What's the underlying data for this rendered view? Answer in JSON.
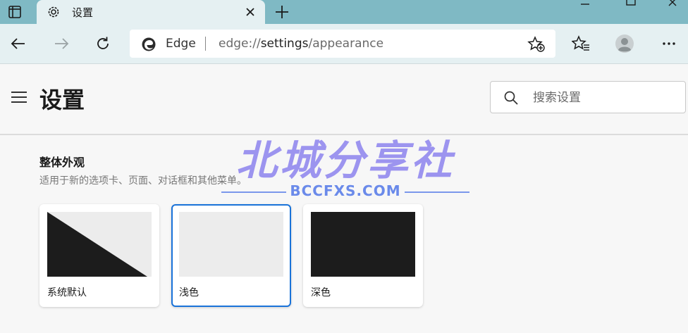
{
  "tab": {
    "title": "设置"
  },
  "address": {
    "site_label": "Edge",
    "url_scheme": "edge://",
    "url_host": "settings",
    "url_path": "/appearance"
  },
  "header": {
    "title": "设置",
    "search_placeholder": "搜索设置"
  },
  "section": {
    "title": "整体外观",
    "description": "适用于新的选项卡、页面、对话框和其他菜单。"
  },
  "themes": [
    {
      "label": "系统默认",
      "selected": false
    },
    {
      "label": "浅色",
      "selected": true
    },
    {
      "label": "深色",
      "selected": false
    }
  ],
  "watermark": {
    "main": "北城分享社",
    "sub": "BCCFXS.COM"
  },
  "colors": {
    "tab_strip": "#7fb9c4",
    "toolbar": "#e5f0f2",
    "accent": "#1a73d9",
    "dark_theme": "#1c1c1c",
    "light_theme": "#ececec"
  },
  "icons": {
    "tab_actions": "tab-actions-icon",
    "tab_favicon": "gear-icon",
    "tab_close": "close-icon",
    "new_tab": "plus-icon",
    "back": "back-arrow-icon",
    "forward": "forward-arrow-icon",
    "refresh": "refresh-icon",
    "edge": "edge-logo-icon",
    "add_favorite": "star-add-icon",
    "favorites": "favorites-icon",
    "profile": "profile-icon",
    "more": "more-icon",
    "menu": "hamburger-icon",
    "search": "search-icon"
  }
}
